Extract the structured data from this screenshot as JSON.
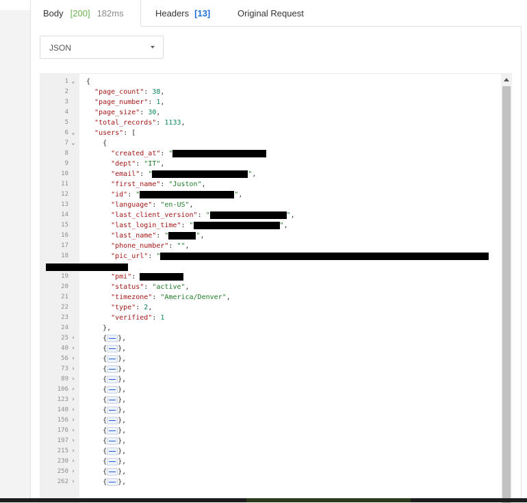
{
  "tabs": {
    "body_label": "Body",
    "status_code": "[200]",
    "timing": "182ms",
    "headers_label": "Headers",
    "headers_count": "[13]",
    "original_request_label": "Original Request"
  },
  "format_select": {
    "value": "JSON"
  },
  "editor": {
    "line_numbers": [
      "1",
      "2",
      "3",
      "4",
      "5",
      "6",
      "7",
      "8",
      "9",
      "10",
      "11",
      "12",
      "13",
      "14",
      "15",
      "16",
      "17",
      "18",
      "19",
      "20",
      "21",
      "22",
      "23",
      "24"
    ],
    "collapsed_line_numbers": [
      "25",
      "40",
      "56",
      "73",
      "89",
      "106",
      "123",
      "140",
      "156",
      "176",
      "197",
      "215",
      "230",
      "250",
      "262"
    ],
    "punct": {
      "open_brace": "{",
      "open_bracket": "[",
      "colon": ": ",
      "comma": ",",
      "close_obj": "},",
      "quote": "\"",
      "collapsed_open": "{",
      "collapsed_close": "},"
    },
    "keys": {
      "page_count": "\"page_count\"",
      "page_number": "\"page_number\"",
      "page_size": "\"page_size\"",
      "total_records": "\"total_records\"",
      "users": "\"users\"",
      "created_at": "\"created_at\"",
      "dept": "\"dept\"",
      "email": "\"email\"",
      "first_name": "\"first_name\"",
      "id": "\"id\"",
      "language": "\"language\"",
      "last_client_version": "\"last_client_version\"",
      "last_login_time": "\"last_login_time\"",
      "last_name": "\"last_name\"",
      "phone_number": "\"phone_number\"",
      "pic_url": "\"pic_url\"",
      "pmi": "\"pmi\"",
      "status": "\"status\"",
      "timezone": "\"timezone\"",
      "type": "\"type\"",
      "verified": "\"verified\""
    },
    "values": {
      "page_count": "38",
      "page_number": "1",
      "page_size": "30",
      "total_records": "1133",
      "dept": "\"IT\"",
      "first_name": "\"Juston\"",
      "language": "\"en-US\"",
      "phone_number": "\"\"",
      "status": "\"active\"",
      "timezone": "\"America/Denver\"",
      "type": "2",
      "verified": "1"
    }
  }
}
